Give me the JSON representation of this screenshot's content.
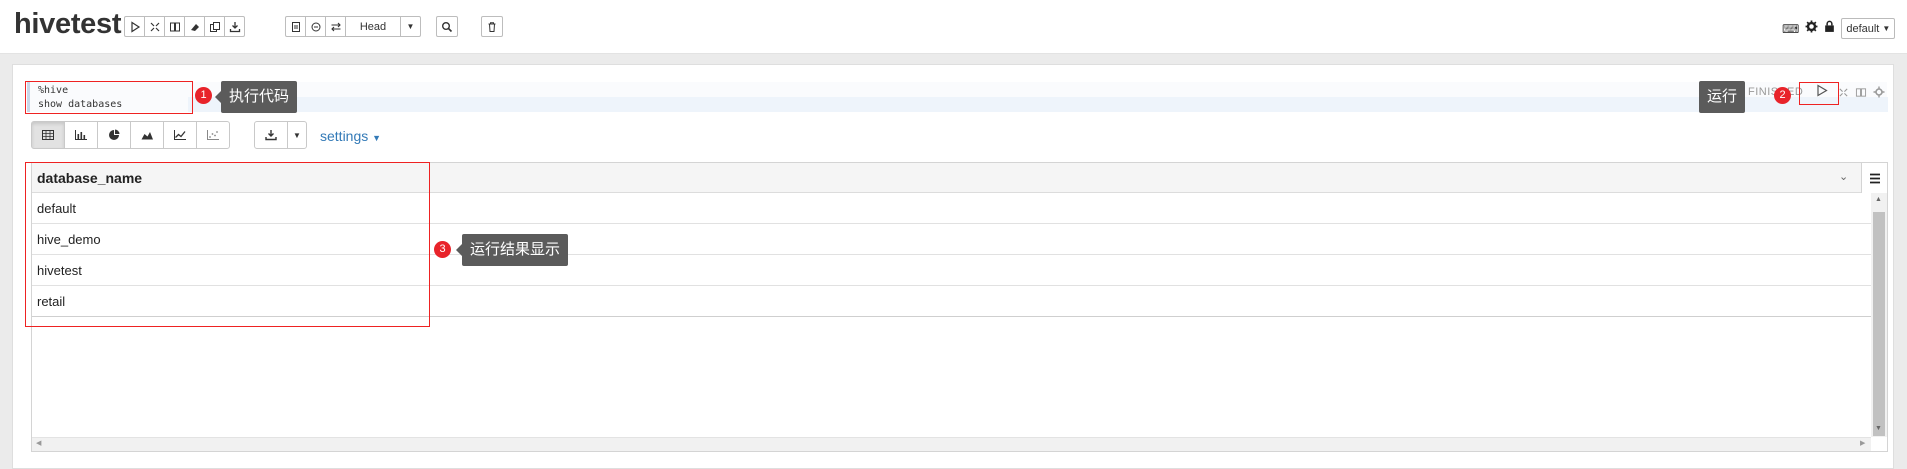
{
  "header": {
    "title": "hivetest",
    "head_label": "Head",
    "interpreter_binding": "default",
    "icons": [
      "run-all-icon",
      "hide-code-icon",
      "show-output-icon",
      "clear-output-icon",
      "clone-icon",
      "export-icon",
      "code-icon",
      "revision-icon",
      "swap-icon",
      "search-icon",
      "trash-icon",
      "keyboard-icon",
      "gear-icon",
      "lock-icon"
    ]
  },
  "paragraph": {
    "code_lines": [
      "%hive",
      "show databases"
    ],
    "status": "FINISHED",
    "settings_label": "settings"
  },
  "table": {
    "column": "database_name",
    "rows": [
      "default",
      "hive_demo",
      "hivetest",
      "retail"
    ]
  },
  "annotations": {
    "one": {
      "num": "1",
      "text": "执行代码"
    },
    "two": {
      "num": "2",
      "text": "运行"
    },
    "three": {
      "num": "3",
      "text": "运行结果显示"
    }
  }
}
